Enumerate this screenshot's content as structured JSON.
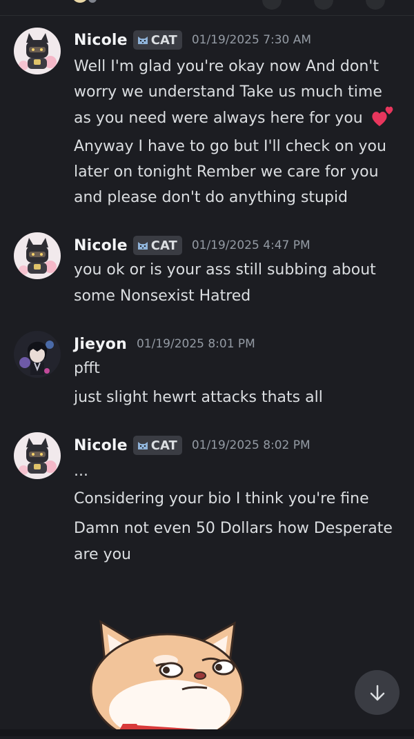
{
  "messages": [
    {
      "author": "Nicole",
      "tag": "CAT",
      "timestamp": "01/19/2025 7:30 AM",
      "lines": [
        "Well I'm glad you're okay now And don't",
        "worry we understand Take us much time",
        "as you need were always here for you",
        "Anyway I have to go but I'll check on you",
        "later on tonight Rember we care for you",
        "and please don't do anything stupid"
      ]
    },
    {
      "author": "Nicole",
      "tag": "CAT",
      "timestamp": "01/19/2025 4:47 PM",
      "lines": [
        "you ok or is your ass still subbing about",
        "some Nonsexist Hatred"
      ]
    },
    {
      "author": "Jieyon",
      "timestamp": "01/19/2025 8:01 PM",
      "lines": [
        "pfft",
        "just slight hewrt attacks thats all"
      ]
    },
    {
      "author": "Nicole",
      "tag": "CAT",
      "timestamp": "01/19/2025 8:02 PM",
      "lines": [
        "...",
        "Considering your bio I think you're fine",
        "Damn not even 50 Dollars how Desperate",
        "are you"
      ]
    }
  ],
  "icons": {
    "tag": "cat-face-icon",
    "reaction": "two-hearts-icon",
    "scroll": "arrow-down-icon",
    "sticker": "shiba-dog-sticker"
  },
  "colors": {
    "background": "#1c1d22",
    "username": "#f2f3f5",
    "text": "#dbdee1",
    "timestamp": "#949ba4",
    "tag_bg": "#3a3c43",
    "heart": "#e8365d"
  }
}
